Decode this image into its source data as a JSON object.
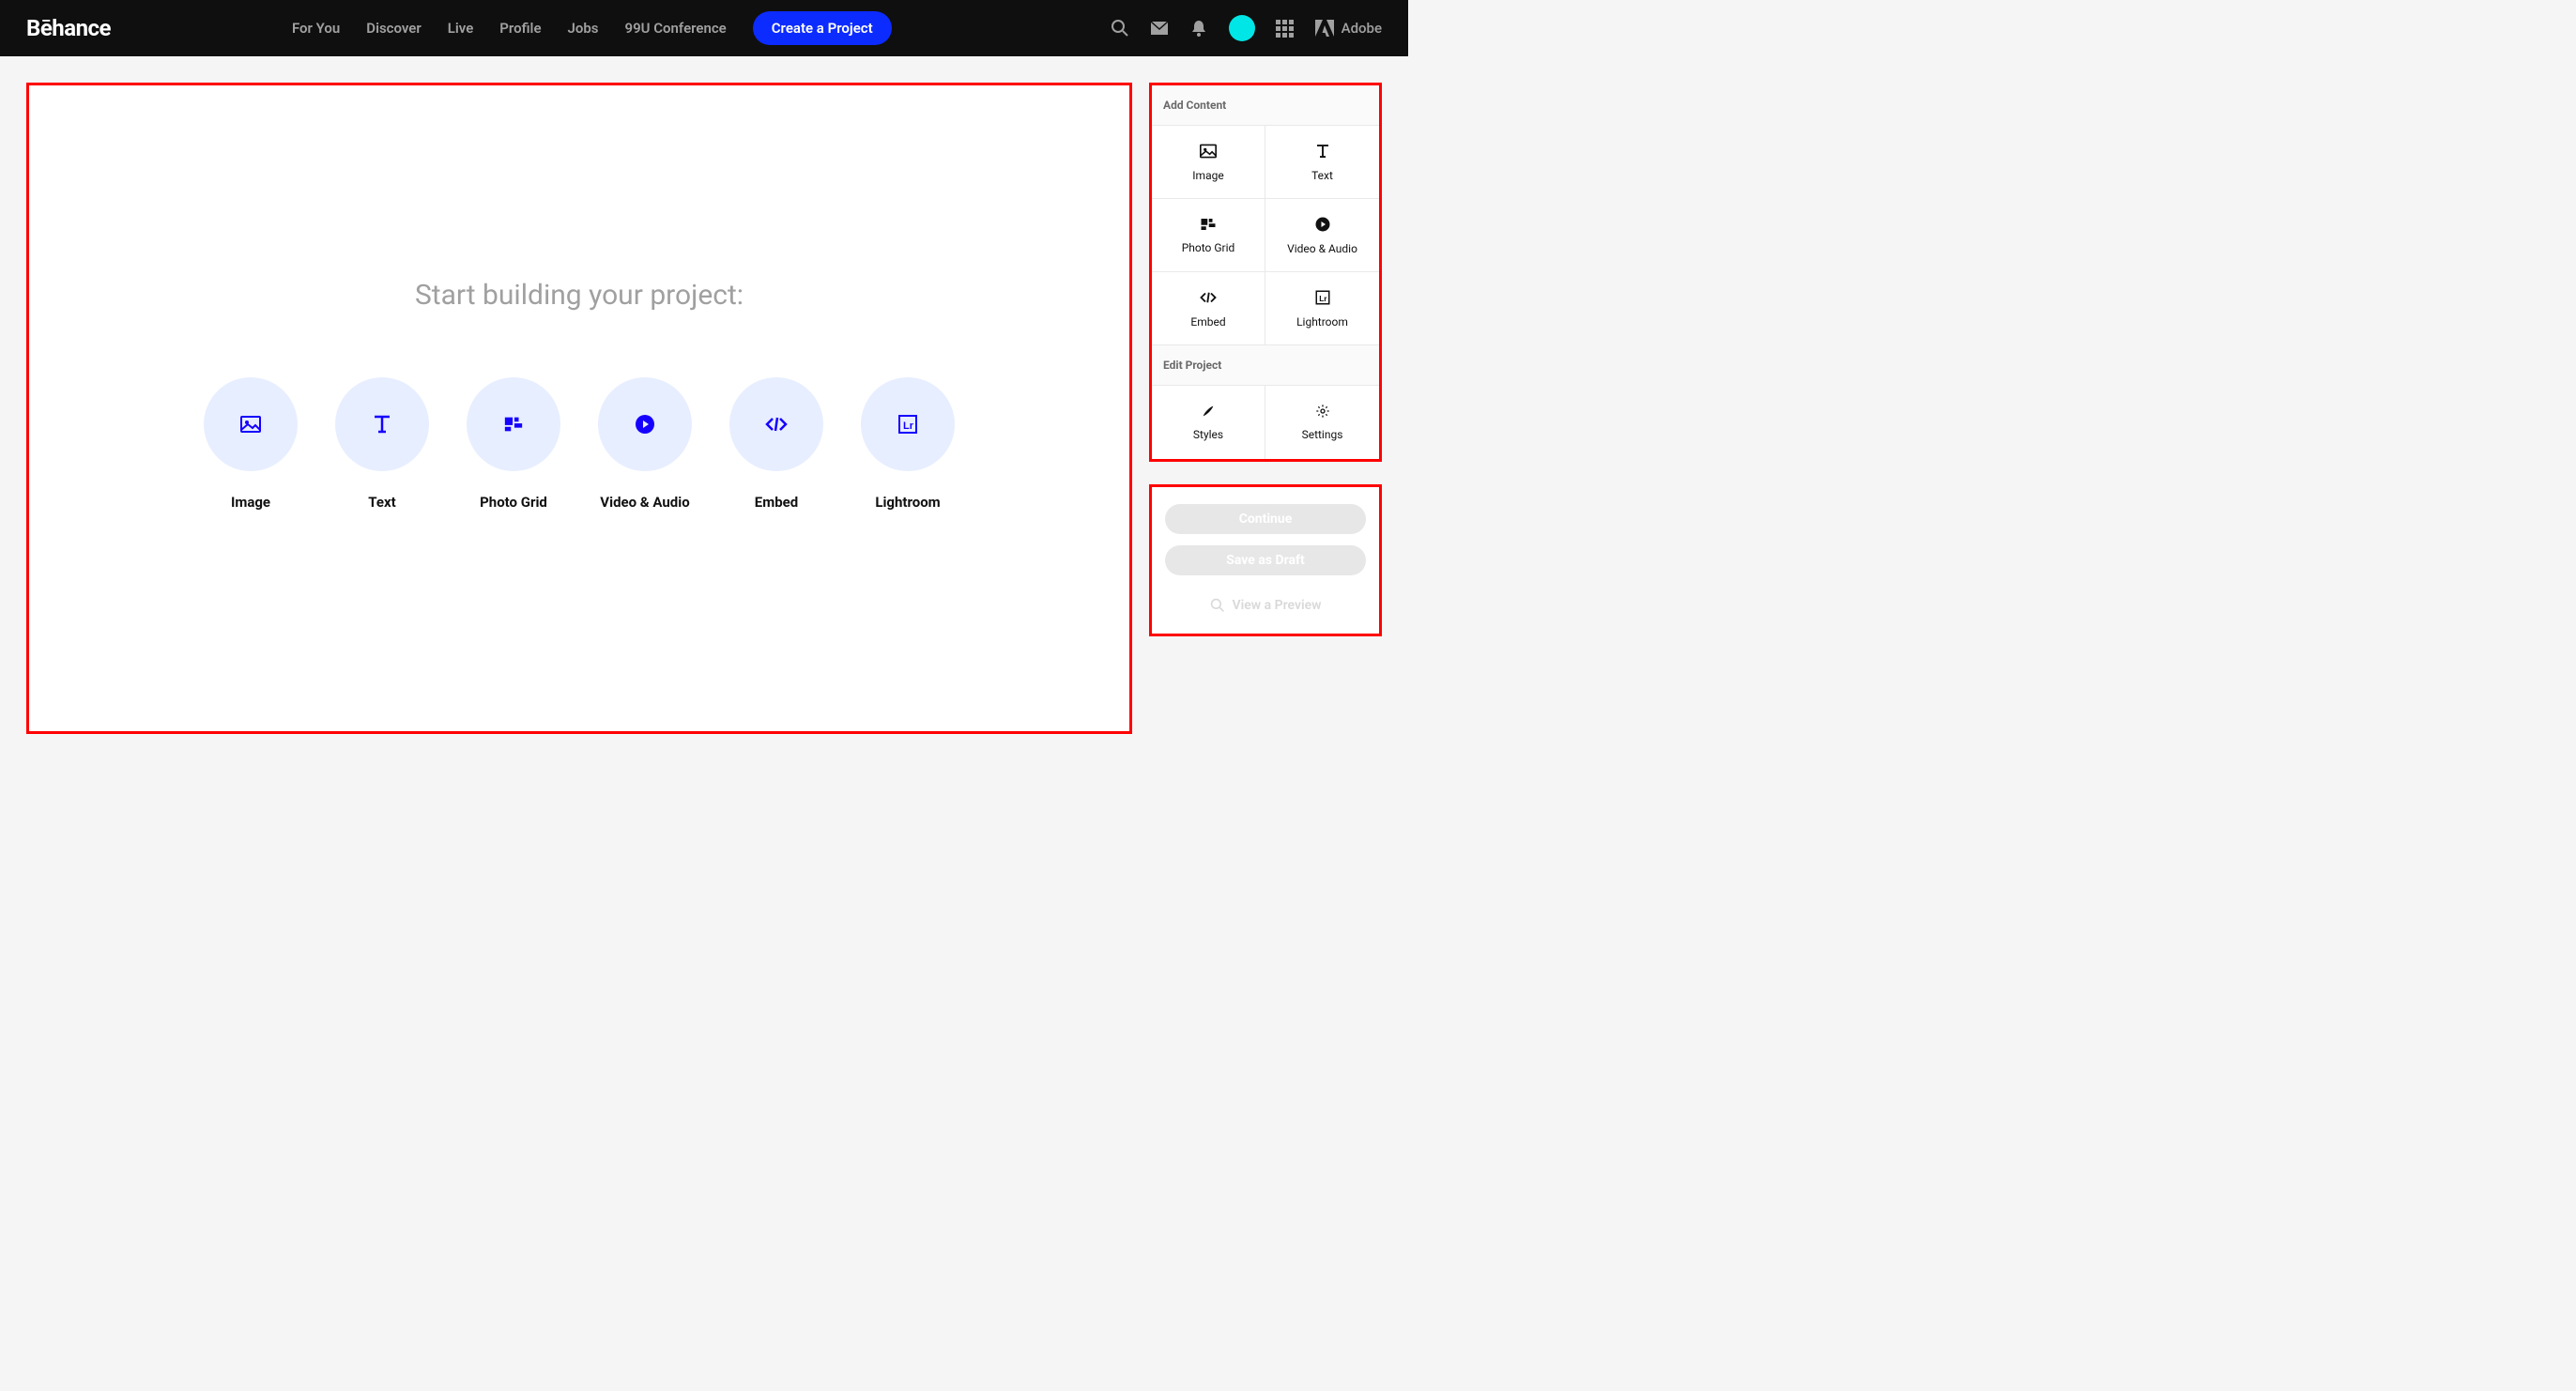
{
  "header": {
    "logo": "Bēhance",
    "nav": {
      "for_you": "For You",
      "discover": "Discover",
      "live": "Live",
      "profile": "Profile",
      "jobs": "Jobs",
      "conference": "99U Conference"
    },
    "cta": "Create a Project",
    "adobe": "Adobe"
  },
  "canvas": {
    "title": "Start building your project:",
    "types": {
      "image": "Image",
      "text": "Text",
      "photo_grid": "Photo Grid",
      "video_audio": "Video & Audio",
      "embed": "Embed",
      "lightroom": "Lightroom"
    }
  },
  "sidebar": {
    "add_content_heading": "Add Content",
    "add": {
      "image": "Image",
      "text": "Text",
      "photo_grid": "Photo Grid",
      "video_audio": "Video & Audio",
      "embed": "Embed",
      "lightroom": "Lightroom"
    },
    "edit_project_heading": "Edit Project",
    "edit": {
      "styles": "Styles",
      "settings": "Settings"
    }
  },
  "actions": {
    "continue": "Continue",
    "save_draft": "Save as Draft",
    "preview": "View a Preview"
  }
}
